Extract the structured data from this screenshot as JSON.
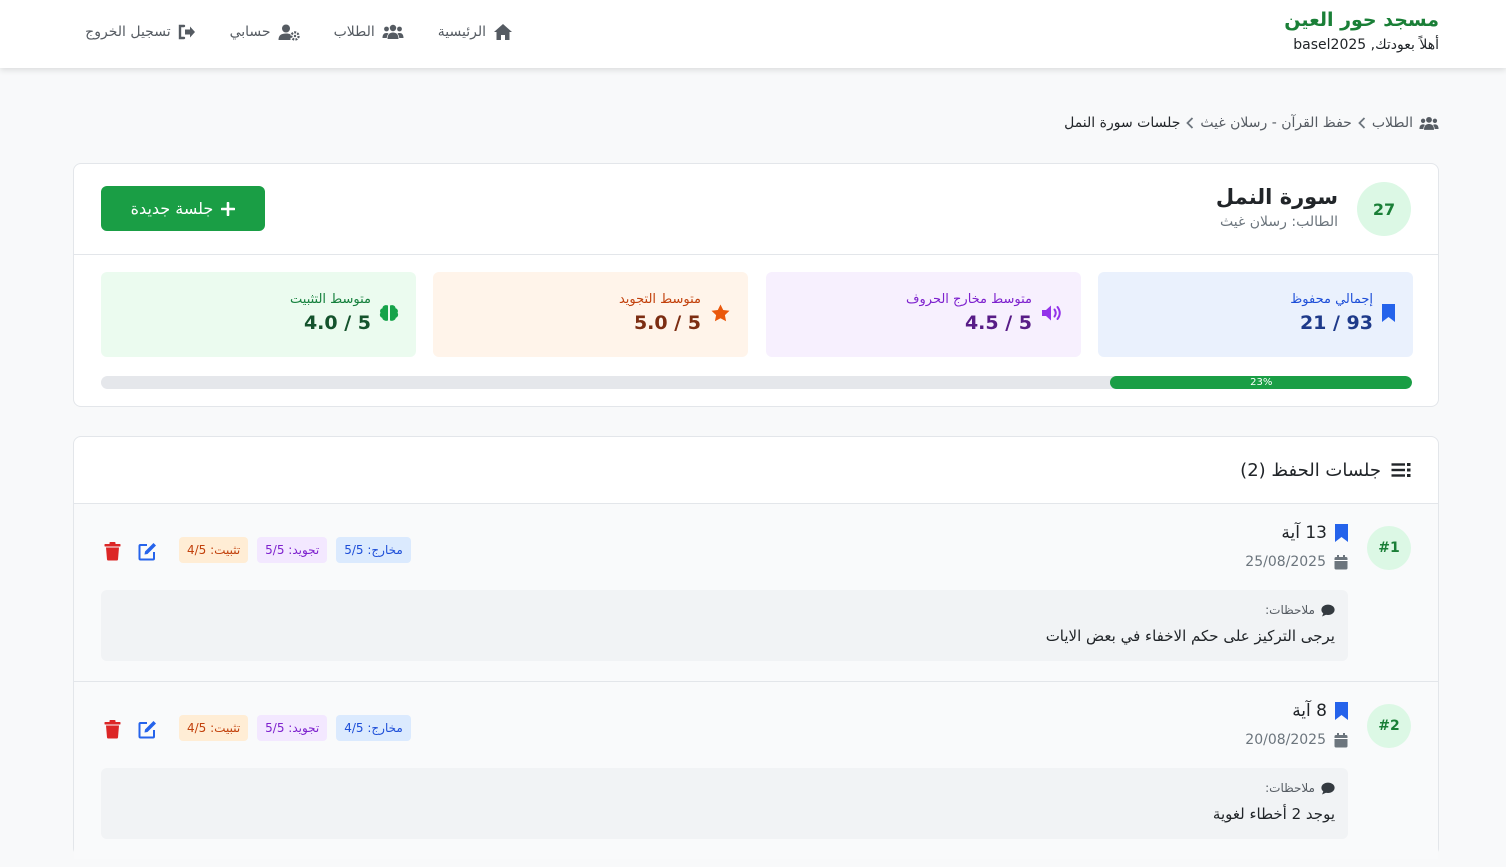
{
  "brand": {
    "title": "مسجد حور العين",
    "welcome": "أهلاً بعودتك, basel2025"
  },
  "nav": {
    "home": "الرئيسية",
    "students": "الطلاب",
    "account": "حسابي",
    "logout": "تسجيل الخروج"
  },
  "breadcrumb": {
    "students": "الطلاب",
    "program": "حفظ القرآن - رسلان غيث",
    "current": "جلسات سورة النمل"
  },
  "summary": {
    "surah_number": "27",
    "surah_name": "سورة النمل",
    "student": "الطالب: رسلان غيث",
    "new_session_button": "جلسة جديدة",
    "stats": {
      "memorized": {
        "label": "إجمالي محفوظ",
        "value": "21 / 93"
      },
      "makharij": {
        "label": "متوسط مخارج الحروف",
        "value": "4.5 / 5"
      },
      "tajweed": {
        "label": "متوسط التجويد",
        "value": "5.0 / 5"
      },
      "tathbeet": {
        "label": "متوسط التثبيت",
        "value": "4.0 / 5"
      }
    },
    "progress": {
      "percent": 23,
      "label": "23%"
    }
  },
  "sessions": {
    "title": "جلسات الحفظ (2)",
    "items": [
      {
        "number": "#1",
        "ayah": "13 آية",
        "date": "25/08/2025",
        "makharij": "مخارج: 5/5",
        "tajweed": "تجويد: 5/5",
        "tathbeet": "تثبيت: 4/5",
        "notes_label": "ملاحظات:",
        "notes": "يرجى التركيز على حكم الاخفاء في بعض الايات"
      },
      {
        "number": "#2",
        "ayah": "8 آية",
        "date": "20/08/2025",
        "makharij": "مخارج: 4/5",
        "tajweed": "تجويد: 5/5",
        "tathbeet": "تثبيت: 4/5",
        "notes_label": "ملاحظات:",
        "notes": "يوجد 2 أخطاء لغوية"
      }
    ]
  },
  "colors": {
    "brand_green": "#1a7f37",
    "button_green": "#1a9e45",
    "blue": "#2563eb",
    "purple": "#7e22ce",
    "orange": "#ea580c",
    "red": "#dc2626"
  }
}
